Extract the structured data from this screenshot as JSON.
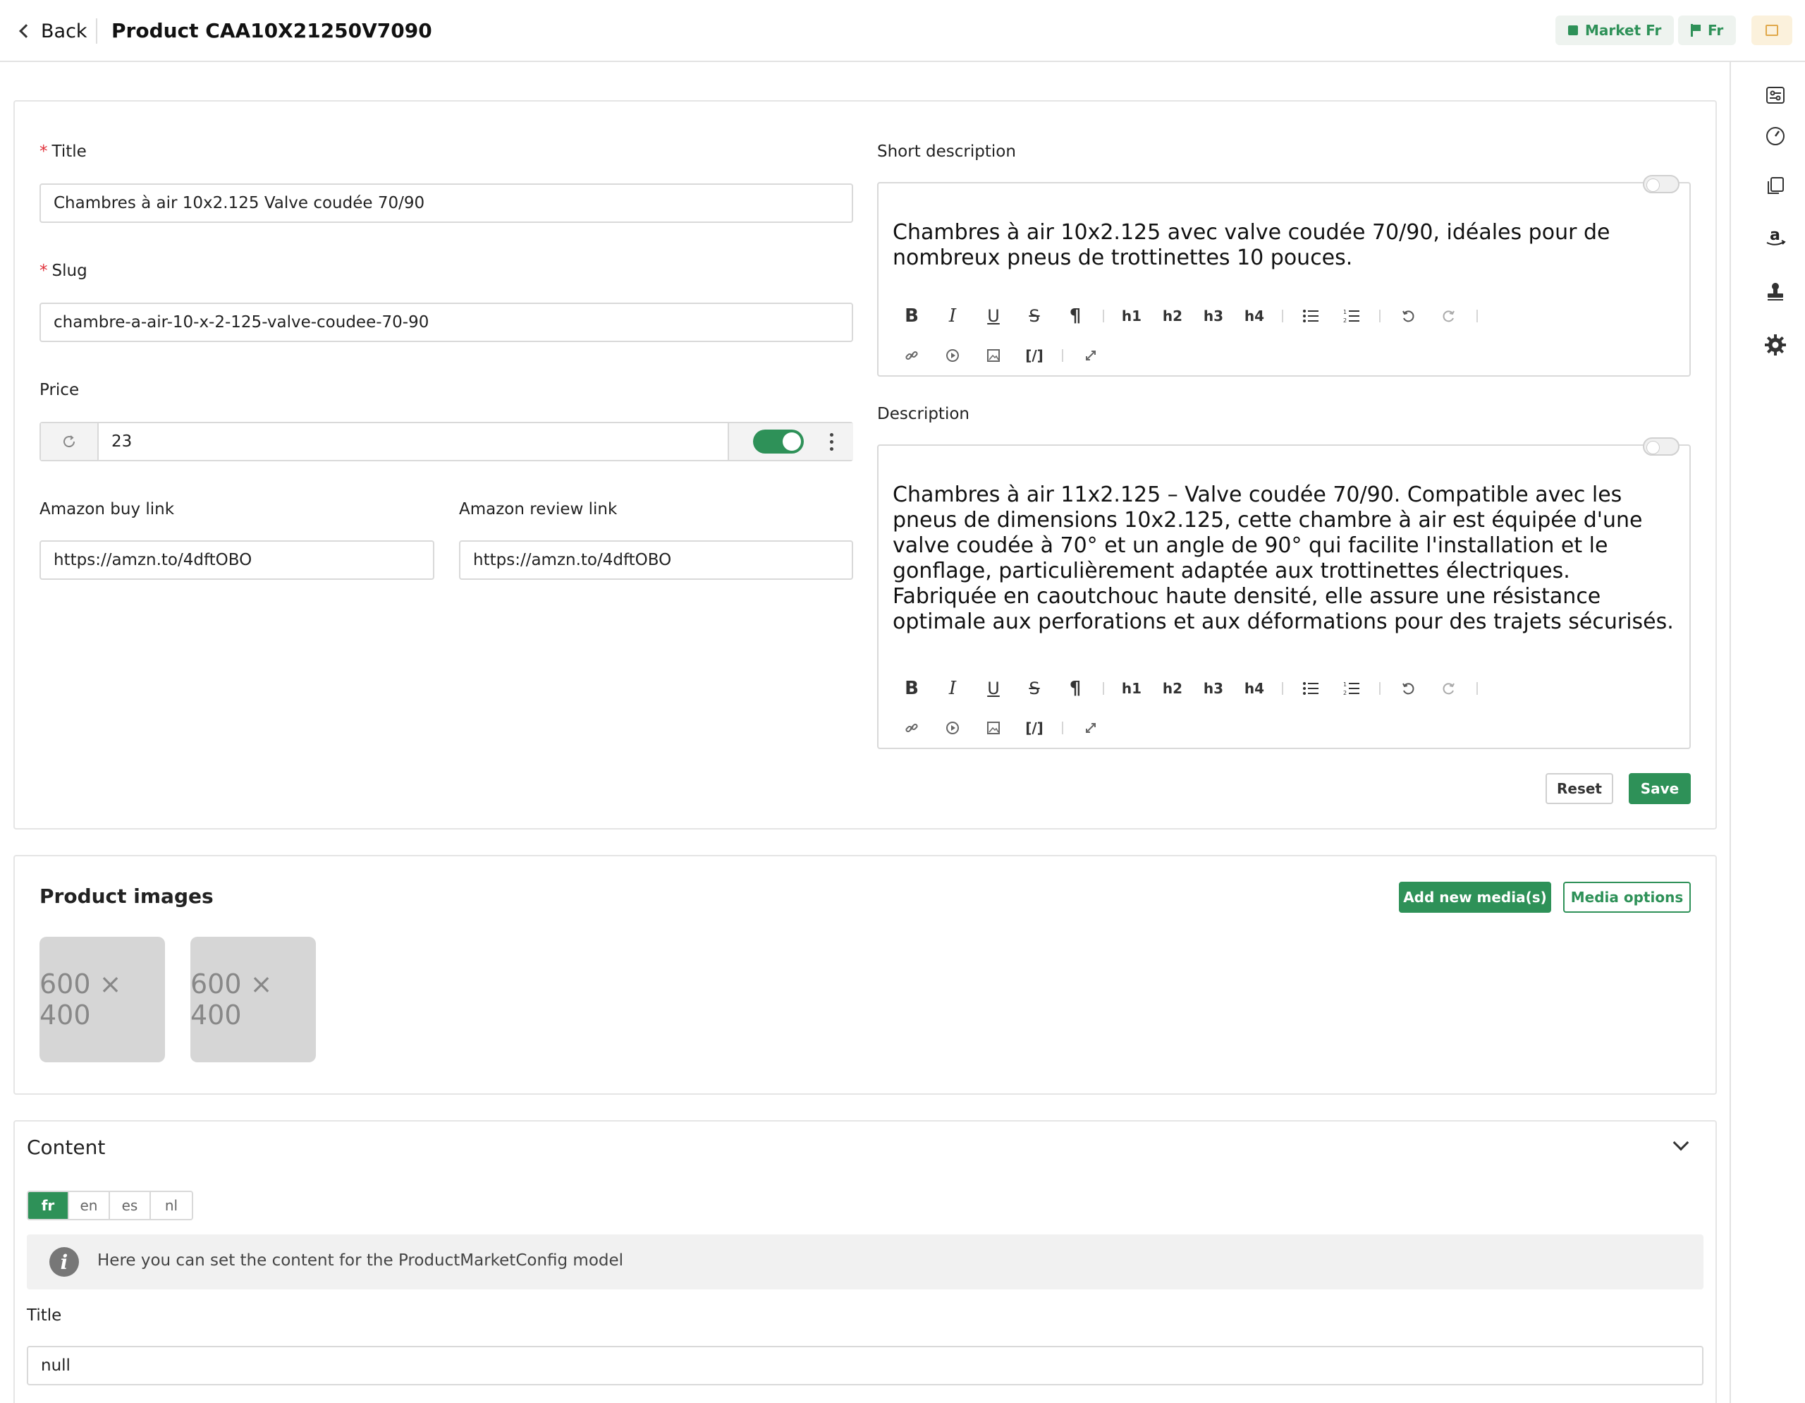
{
  "header": {
    "back_label": "Back",
    "title": "Product CAA10X21250V7090",
    "market_label": "Market Fr",
    "locale_label": "Fr"
  },
  "form": {
    "title_label": "Title",
    "title_value": "Chambres à air 10x2.125 Valve coudée 70/90",
    "slug_label": "Slug",
    "slug_value": "chambre-a-air-10-x-2-125-valve-coudee-70-90",
    "price_label": "Price",
    "price_value": "23",
    "price_enabled": true,
    "amazon_buy_label": "Amazon buy link",
    "amazon_buy_value": "https://amzn.to/4dftOBO",
    "amazon_review_label": "Amazon review link",
    "amazon_review_value": "https://amzn.to/4dftOBO",
    "short_desc_label": "Short description",
    "short_desc_text": "Chambres à air 10x2.125 avec valve coudée 70/90, idéales pour de nombreux pneus de trottinettes 10 pouces.",
    "desc_label": "Description",
    "desc_text": "Chambres à air 11x2.125 – Valve coudée 70/90. Compatible avec les pneus de dimensions 10x2.125, cette chambre à air est équipée d'une valve coudée à 70° et un angle de 90° qui facilite l'installation et le gonflage, particulièrement adaptée aux trottinettes électriques. Fabriquée en caoutchouc haute densité, elle assure une résistance optimale aux perforations et aux déformations pour des trajets sécurisés.",
    "reset_label": "Reset",
    "save_label": "Save"
  },
  "toolbar": {
    "h1": "h1",
    "h2": "h2",
    "h3": "h3",
    "h4": "h4"
  },
  "images": {
    "title": "Product images",
    "add_label": "Add new media(s)",
    "options_label": "Media options",
    "items": [
      {
        "label": "600 × 400"
      },
      {
        "label": "600 × 400"
      }
    ]
  },
  "content": {
    "title": "Content",
    "langs": [
      "fr",
      "en",
      "es",
      "nl"
    ],
    "active_lang": "fr",
    "info_text": "Here you can set the content for the ProductMarketConfig model",
    "title_label": "Title",
    "title_value": "null"
  },
  "colors": {
    "accent": "#2e9158",
    "required": "#e0303a",
    "border": "#d9d9d9"
  },
  "sidebar_icons": [
    "sliders-card-icon",
    "gauge-icon",
    "copy-icon",
    "amazon-icon",
    "stamp-icon",
    "gear-icon"
  ]
}
